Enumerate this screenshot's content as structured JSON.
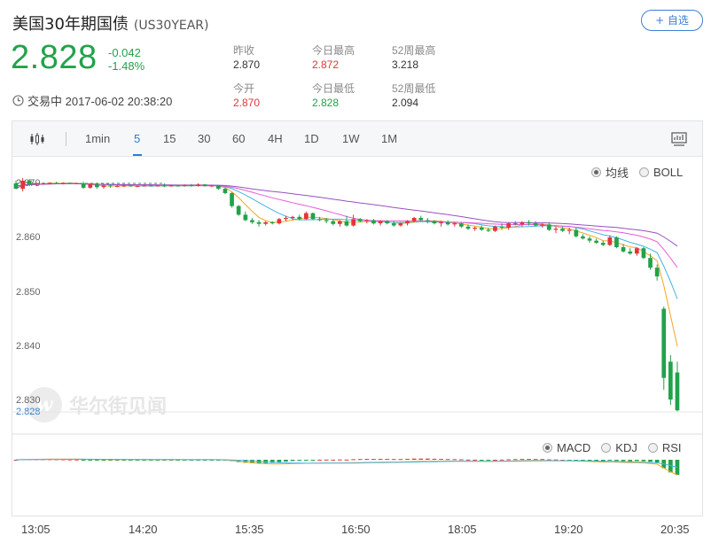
{
  "header": {
    "title": "美国30年期国债",
    "code": "(US30YEAR)",
    "watch_label": "+ 自选"
  },
  "quote": {
    "price": "2.828",
    "change": "-0.042",
    "change_pct": "-1.48%",
    "status": "交易中 2017-06-02 20:38:20"
  },
  "stats": [
    {
      "label": "昨收",
      "value": "2.870",
      "color": "dark"
    },
    {
      "label": "今日最高",
      "value": "2.872",
      "color": "red"
    },
    {
      "label": "52周最高",
      "value": "3.218",
      "color": "dark"
    },
    {
      "label": "今开",
      "value": "2.870",
      "color": "red"
    },
    {
      "label": "今日最低",
      "value": "2.828",
      "color": "green"
    },
    {
      "label": "52周最低",
      "value": "2.094",
      "color": "dark"
    }
  ],
  "toolbar": {
    "items": [
      "1min",
      "5",
      "15",
      "30",
      "60",
      "4H",
      "1D",
      "1W",
      "1M"
    ],
    "active": "5"
  },
  "indicators": {
    "main": [
      "均线",
      "BOLL"
    ],
    "sub": [
      "MACD",
      "KDJ",
      "RSI"
    ]
  },
  "watermark": "华尔街见闻",
  "colors": {
    "up": "#e2353a",
    "down": "#22a24a",
    "accent": "#2f7bd1"
  },
  "chart_data": {
    "type": "candlestick",
    "interval": "5",
    "y_ticks": [
      "2.870",
      "2.860",
      "2.850",
      "2.840",
      "2.830"
    ],
    "ylim": [
      2.828,
      2.872
    ],
    "last_price_label": "2.828",
    "x_ticks": [
      "13:05",
      "14:20",
      "15:35",
      "16:50",
      "18:05",
      "19:20",
      "20:35"
    ],
    "candles": [
      [
        2.87,
        2.8705,
        2.869,
        2.869
      ],
      [
        2.869,
        2.871,
        2.8685,
        2.8705
      ],
      [
        2.8705,
        2.8708,
        2.8695,
        2.8698
      ],
      [
        2.8698,
        2.8702,
        2.8695,
        2.87
      ],
      [
        2.87,
        2.8702,
        2.8698,
        2.87
      ],
      [
        2.87,
        2.8702,
        2.8698,
        2.8701
      ],
      [
        2.8701,
        2.8703,
        2.8699,
        2.87
      ],
      [
        2.87,
        2.8702,
        2.8698,
        2.8701
      ],
      [
        2.8701,
        2.8702,
        2.8699,
        2.87
      ],
      [
        2.87,
        2.8701,
        2.8699,
        2.87
      ],
      [
        2.87,
        2.8703,
        2.869,
        2.8692
      ],
      [
        2.8692,
        2.87,
        2.869,
        2.8698
      ],
      [
        2.8698,
        2.87,
        2.869,
        2.8693
      ],
      [
        2.8693,
        2.8698,
        2.869,
        2.8696
      ],
      [
        2.8696,
        2.8698,
        2.8692,
        2.8695
      ],
      [
        2.8695,
        2.8697,
        2.8693,
        2.8695
      ],
      [
        2.8695,
        2.8697,
        2.8693,
        2.8696
      ],
      [
        2.8696,
        2.8697,
        2.8694,
        2.8695
      ],
      [
        2.8695,
        2.8696,
        2.8694,
        2.8695
      ],
      [
        2.8695,
        2.8697,
        2.8694,
        2.8696
      ],
      [
        2.8696,
        2.8697,
        2.8694,
        2.8695
      ],
      [
        2.8695,
        2.8697,
        2.8694,
        2.8696
      ],
      [
        2.8696,
        2.87,
        2.8693,
        2.8695
      ],
      [
        2.8695,
        2.8697,
        2.8694,
        2.8696
      ],
      [
        2.8696,
        2.8697,
        2.8694,
        2.8695
      ],
      [
        2.8695,
        2.8698,
        2.8694,
        2.8697
      ],
      [
        2.8697,
        2.8699,
        2.8694,
        2.8695
      ],
      [
        2.8695,
        2.87,
        2.8694,
        2.8698
      ],
      [
        2.8698,
        2.8699,
        2.8694,
        2.8695
      ],
      [
        2.8695,
        2.8697,
        2.8693,
        2.8696
      ],
      [
        2.8696,
        2.8697,
        2.8688,
        2.869
      ],
      [
        2.869,
        2.8693,
        2.868,
        2.8682
      ],
      [
        2.8682,
        2.8684,
        2.8655,
        2.8658
      ],
      [
        2.8658,
        2.866,
        2.864,
        2.8642
      ],
      [
        2.8642,
        2.8648,
        2.863,
        2.8632
      ],
      [
        2.8632,
        2.8636,
        2.8625,
        2.8628
      ],
      [
        2.8628,
        2.8632,
        2.862,
        2.8625
      ],
      [
        2.8625,
        2.863,
        2.8622,
        2.8628
      ],
      [
        2.8628,
        2.863,
        2.8624,
        2.8626
      ],
      [
        2.8626,
        2.8636,
        2.8624,
        2.8634
      ],
      [
        2.8634,
        2.864,
        2.863,
        2.8636
      ],
      [
        2.8636,
        2.864,
        2.8632,
        2.8638
      ],
      [
        2.8638,
        2.8642,
        2.8632,
        2.8634
      ],
      [
        2.8634,
        2.8648,
        2.8632,
        2.8645
      ],
      [
        2.8645,
        2.8646,
        2.8632,
        2.8634
      ],
      [
        2.8634,
        2.8638,
        2.863,
        2.8632
      ],
      [
        2.8632,
        2.8636,
        2.8626,
        2.863
      ],
      [
        2.863,
        2.8634,
        2.8622,
        2.8625
      ],
      [
        2.8625,
        2.8632,
        2.862,
        2.863
      ],
      [
        2.863,
        2.864,
        2.862,
        2.8622
      ],
      [
        2.8622,
        2.8642,
        2.862,
        2.8634
      ],
      [
        2.8634,
        2.8636,
        2.8628,
        2.863
      ],
      [
        2.863,
        2.8634,
        2.8626,
        2.8632
      ],
      [
        2.8632,
        2.8634,
        2.8624,
        2.8626
      ],
      [
        2.8626,
        2.8632,
        2.8622,
        2.863
      ],
      [
        2.863,
        2.8632,
        2.8624,
        2.8626
      ],
      [
        2.8626,
        2.863,
        2.862,
        2.8622
      ],
      [
        2.8622,
        2.8628,
        2.862,
        2.8626
      ],
      [
        2.8626,
        2.8632,
        2.8622,
        2.863
      ],
      [
        2.863,
        2.8638,
        2.8628,
        2.8636
      ],
      [
        2.8636,
        2.864,
        2.863,
        2.8632
      ],
      [
        2.8632,
        2.8636,
        2.8626,
        2.863
      ],
      [
        2.863,
        2.8632,
        2.8624,
        2.8626
      ],
      [
        2.8626,
        2.863,
        2.862,
        2.8628
      ],
      [
        2.8628,
        2.8632,
        2.8622,
        2.8624
      ],
      [
        2.8624,
        2.8628,
        2.862,
        2.8626
      ],
      [
        2.8626,
        2.8628,
        2.8618,
        2.862
      ],
      [
        2.862,
        2.8624,
        2.8614,
        2.8616
      ],
      [
        2.8616,
        2.862,
        2.8612,
        2.8618
      ],
      [
        2.8618,
        2.8622,
        2.8612,
        2.8614
      ],
      [
        2.8614,
        2.8618,
        2.861,
        2.8612
      ],
      [
        2.8612,
        2.8622,
        2.861,
        2.862
      ],
      [
        2.862,
        2.8626,
        2.8614,
        2.8618
      ],
      [
        2.8618,
        2.8628,
        2.8614,
        2.8626
      ],
      [
        2.8626,
        2.863,
        2.8622,
        2.8624
      ],
      [
        2.8624,
        2.863,
        2.862,
        2.8628
      ],
      [
        2.8628,
        2.8632,
        2.8622,
        2.8626
      ],
      [
        2.8626,
        2.863,
        2.862,
        2.8622
      ],
      [
        2.8622,
        2.8626,
        2.8618,
        2.8624
      ],
      [
        2.8624,
        2.8628,
        2.8612,
        2.8614
      ],
      [
        2.8614,
        2.862,
        2.8608,
        2.8616
      ],
      [
        2.8616,
        2.862,
        2.861,
        2.8612
      ],
      [
        2.8612,
        2.8618,
        2.8606,
        2.8614
      ],
      [
        2.8614,
        2.8618,
        2.86,
        2.8602
      ],
      [
        2.8602,
        2.8606,
        2.8596,
        2.8598
      ],
      [
        2.8598,
        2.8602,
        2.859,
        2.8594
      ],
      [
        2.8594,
        2.8598,
        2.8588,
        2.859
      ],
      [
        2.859,
        2.8594,
        2.8584,
        2.8586
      ],
      [
        2.8586,
        2.8604,
        2.8584,
        2.86
      ],
      [
        2.86,
        2.8602,
        2.858,
        2.8582
      ],
      [
        2.8582,
        2.8588,
        2.8572,
        2.8574
      ],
      [
        2.8574,
        2.858,
        2.8568,
        2.857
      ],
      [
        2.857,
        2.8582,
        2.8566,
        2.858
      ],
      [
        2.858,
        2.8582,
        2.856,
        2.8562
      ],
      [
        2.8562,
        2.857,
        2.854,
        2.8544
      ],
      [
        2.8544,
        2.855,
        2.852,
        2.8528
      ],
      [
        2.8468,
        2.8472,
        2.8318,
        2.834
      ],
      [
        2.837,
        2.8382,
        2.829,
        2.83
      ],
      [
        2.835,
        2.837,
        2.8278,
        2.828
      ]
    ]
  }
}
